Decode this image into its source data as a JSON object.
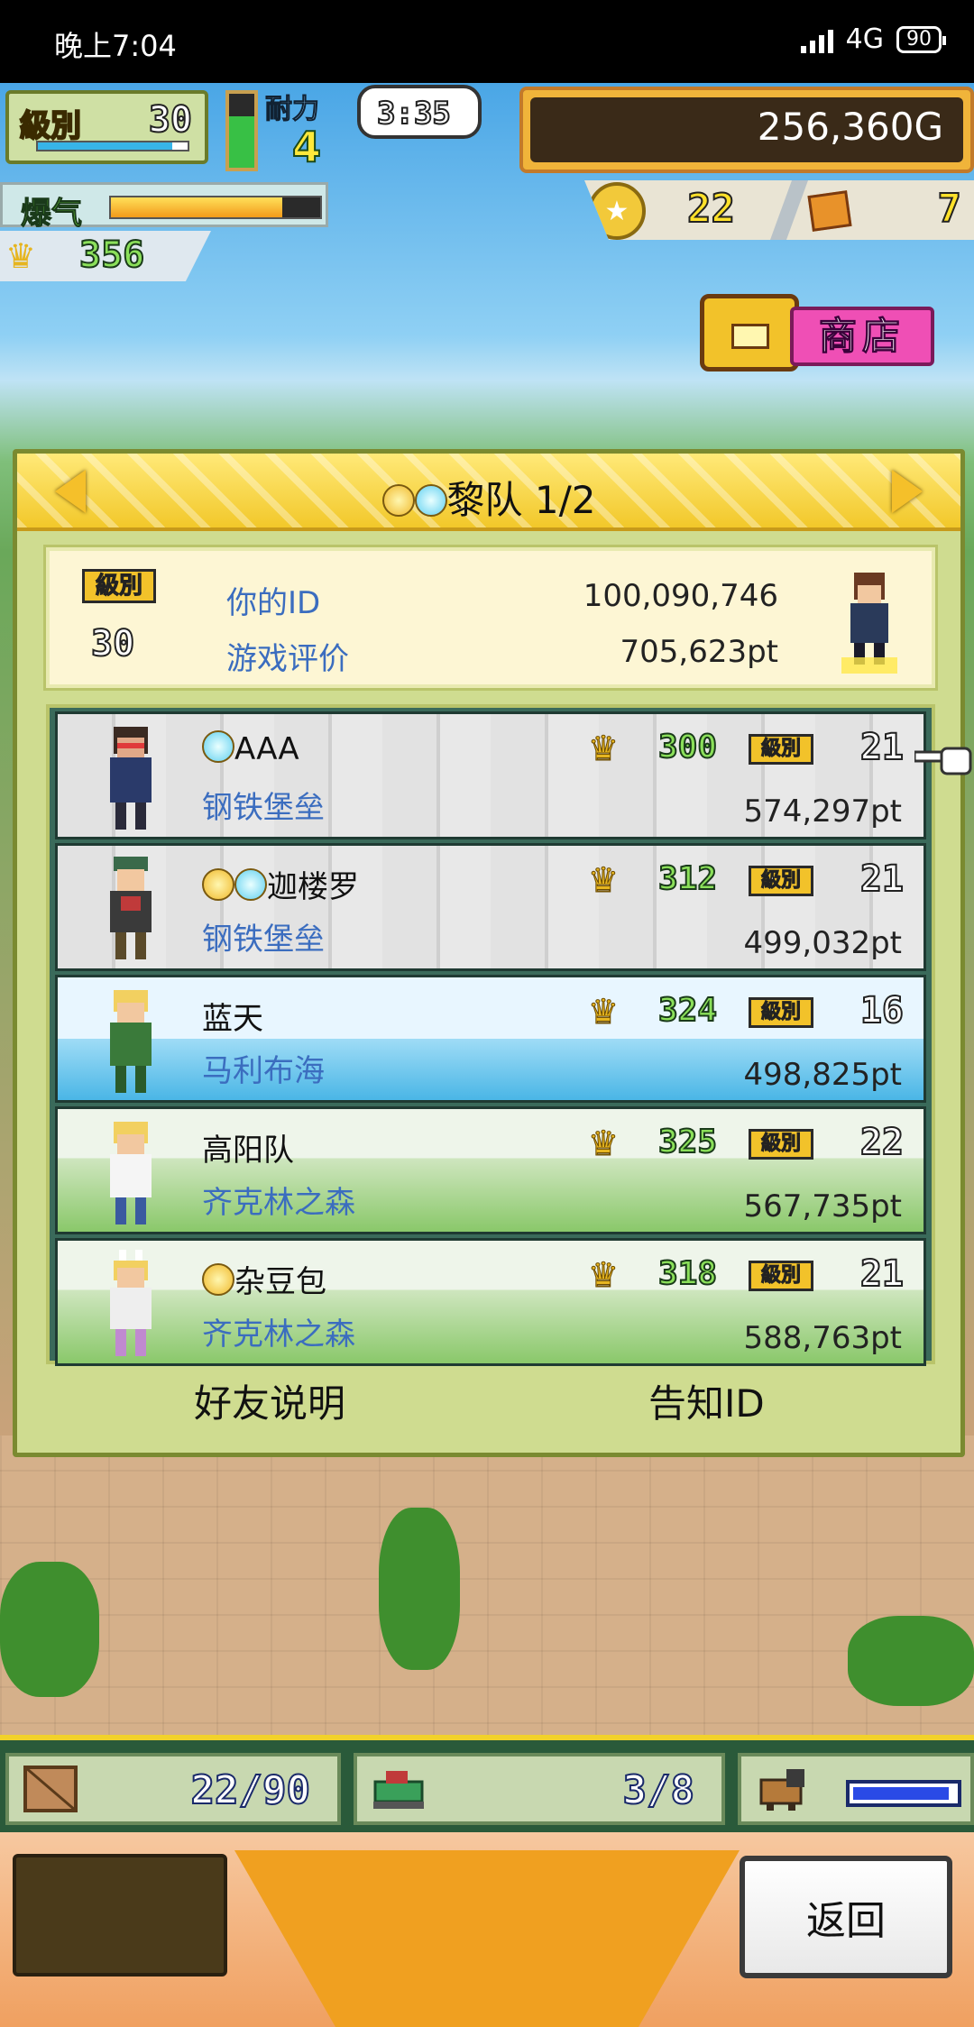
{
  "status_bar": {
    "time": "晚上7:04",
    "network": "4G",
    "battery": "90"
  },
  "hud": {
    "level_label": "級別",
    "level": "30",
    "level_progress": 0.9,
    "stamina_label": "耐力",
    "stamina": "4",
    "timer": "3:35",
    "gold": "256,360G",
    "hype_label": "爆气",
    "hype_fill": 0.82,
    "fans": "356",
    "medals": "22",
    "boxes": "7",
    "shop_label": "商店"
  },
  "dialog": {
    "title": "黎队 1/2",
    "profile": {
      "level_label": "級別",
      "level": "30",
      "id_label": "你的ID",
      "id_value": "100,090,746",
      "rating_label": "游戏评价",
      "rating_value": "705,623pt"
    },
    "rows": [
      {
        "name": "AAA",
        "team": "钢铁堡垒",
        "fans": "300",
        "level_label": "級別",
        "level": "21",
        "points": "574,297pt"
      },
      {
        "name": "迦楼罗",
        "team": "钢铁堡垒",
        "fans": "312",
        "level_label": "級別",
        "level": "21",
        "points": "499,032pt"
      },
      {
        "name": "蓝天",
        "team": "马利布海",
        "fans": "324",
        "level_label": "級別",
        "level": "16",
        "points": "498,825pt"
      },
      {
        "name": "高阳队",
        "team": "齐克林之森",
        "fans": "325",
        "level_label": "級別",
        "level": "22",
        "points": "567,735pt"
      },
      {
        "name": "杂豆包",
        "team": "齐克林之森",
        "fans": "318",
        "level_label": "級別",
        "level": "21",
        "points": "588,763pt"
      }
    ],
    "friend_help_label": "好友说明",
    "notify_id_label": "告知ID"
  },
  "resources": {
    "storage": "22/90",
    "units": "3/8",
    "gauge_fill": 0.95
  },
  "footer": {
    "back_label": "返回"
  },
  "colors": {
    "accent_gold": "#f2c22a",
    "team_blue": "#3b6dbf",
    "fans_green": "#8be05a",
    "shop_pink": "#ef4fb5"
  }
}
